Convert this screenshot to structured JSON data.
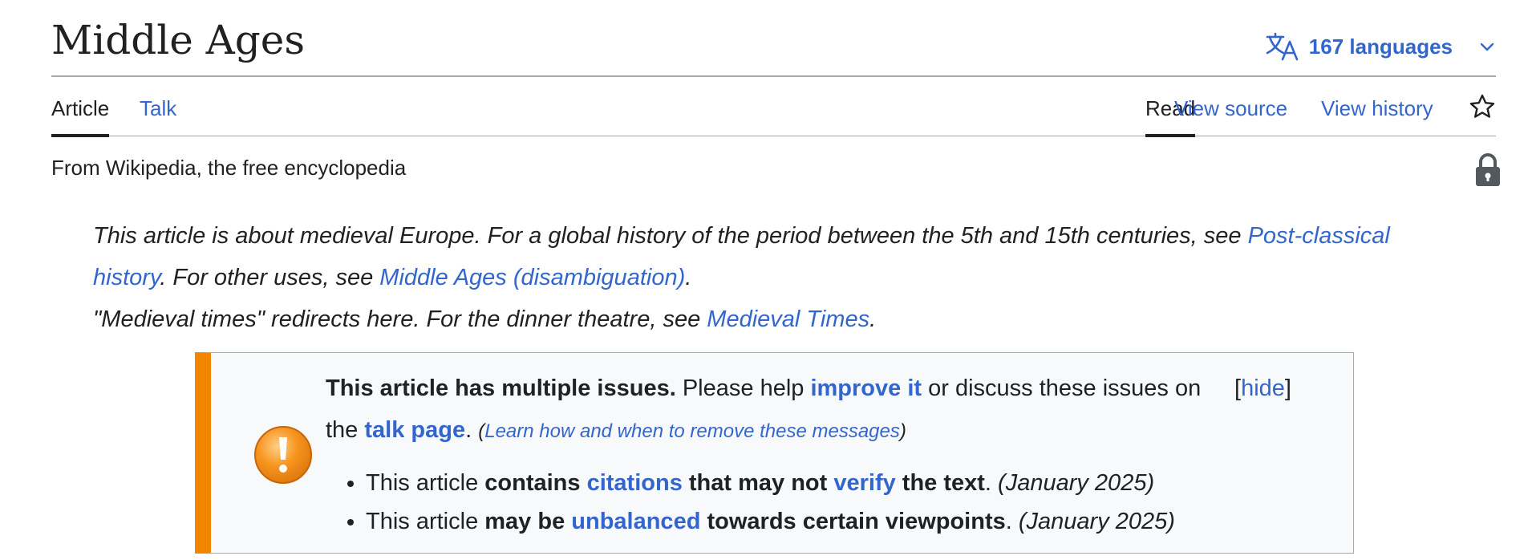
{
  "page": {
    "title": "Middle Ages",
    "languages_label": "167 languages",
    "tagline": "From Wikipedia, the free encyclopedia"
  },
  "tabs": {
    "article": "Article",
    "talk": "Talk",
    "read": "Read",
    "view_source": "View source",
    "view_history": "View history"
  },
  "hatnotes": [
    {
      "t1": "This article is about medieval Europe. For a global history of the period between the 5th and 15th centuries, see ",
      "link1": "Post-classical history",
      "t2": ". For other uses, see ",
      "link2": "Middle Ages (disambiguation)",
      "t3": "."
    },
    {
      "t1": "\"Medieval times\" redirects here. For the dinner theatre, see ",
      "link1": "Medieval Times",
      "t2": "."
    }
  ],
  "ambox": {
    "bold_intro": "This article has multiple issues.",
    "t1": " Please help ",
    "improve_link": "improve it",
    "t2": " or discuss these issues on the ",
    "talk_link": "talk page",
    "t3": ". ",
    "paren_open": "(",
    "learn_link": "Learn how and when to remove these messages",
    "paren_close": ")",
    "hide_open": "[",
    "hide_label": "hide",
    "hide_close": "]",
    "issues": [
      {
        "p1": "This article ",
        "b1": "contains ",
        "link1": "citations",
        "b2": " that may not ",
        "link2": "verify",
        "b3": " the text",
        "p2": ". ",
        "date": "(January 2025)"
      },
      {
        "p1": "This article ",
        "b1": "may be ",
        "link1": "unbalanced",
        "b2": " towards certain viewpoints",
        "p2": ". ",
        "date": "(January 2025)"
      }
    ]
  },
  "colors": {
    "link": "#3366cc",
    "text": "#202122",
    "ambox_accent": "#f28500",
    "ambox_bg": "#f8f9fa"
  }
}
